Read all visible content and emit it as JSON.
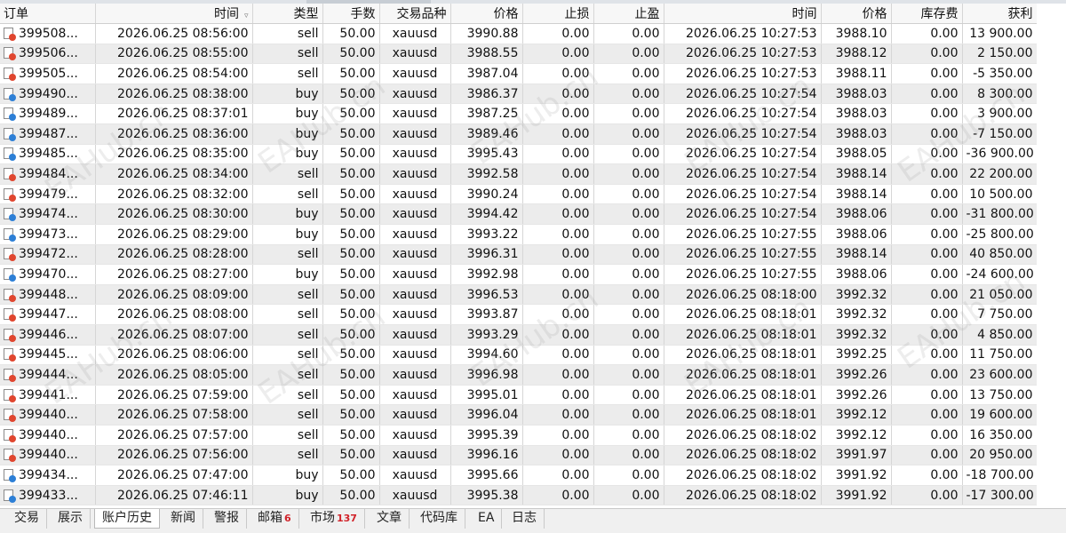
{
  "columns": {
    "order": "订单",
    "open_time": "时间",
    "type": "类型",
    "volume": "手数",
    "symbol": "交易品种",
    "open_price": "价格",
    "stop_loss": "止损",
    "take_profit": "止盈",
    "close_time": "时间",
    "close_price": "价格",
    "swap": "库存费",
    "profit": "获利"
  },
  "rows": [
    [
      "399508...",
      "2026.06.25 08:56:00",
      "sell",
      "50.00",
      "xauusd",
      "3990.88",
      "0.00",
      "0.00",
      "2026.06.25 10:27:53",
      "3988.10",
      "0.00",
      "13 900.00"
    ],
    [
      "399506...",
      "2026.06.25 08:55:00",
      "sell",
      "50.00",
      "xauusd",
      "3988.55",
      "0.00",
      "0.00",
      "2026.06.25 10:27:53",
      "3988.12",
      "0.00",
      "2 150.00"
    ],
    [
      "399505...",
      "2026.06.25 08:54:00",
      "sell",
      "50.00",
      "xauusd",
      "3987.04",
      "0.00",
      "0.00",
      "2026.06.25 10:27:53",
      "3988.11",
      "0.00",
      "-5 350.00"
    ],
    [
      "399490...",
      "2026.06.25 08:38:00",
      "buy",
      "50.00",
      "xauusd",
      "3986.37",
      "0.00",
      "0.00",
      "2026.06.25 10:27:54",
      "3988.03",
      "0.00",
      "8 300.00"
    ],
    [
      "399489...",
      "2026.06.25 08:37:01",
      "buy",
      "50.00",
      "xauusd",
      "3987.25",
      "0.00",
      "0.00",
      "2026.06.25 10:27:54",
      "3988.03",
      "0.00",
      "3 900.00"
    ],
    [
      "399487...",
      "2026.06.25 08:36:00",
      "buy",
      "50.00",
      "xauusd",
      "3989.46",
      "0.00",
      "0.00",
      "2026.06.25 10:27:54",
      "3988.03",
      "0.00",
      "-7 150.00"
    ],
    [
      "399485...",
      "2026.06.25 08:35:00",
      "buy",
      "50.00",
      "xauusd",
      "3995.43",
      "0.00",
      "0.00",
      "2026.06.25 10:27:54",
      "3988.05",
      "0.00",
      "-36 900.00"
    ],
    [
      "399484...",
      "2026.06.25 08:34:00",
      "sell",
      "50.00",
      "xauusd",
      "3992.58",
      "0.00",
      "0.00",
      "2026.06.25 10:27:54",
      "3988.14",
      "0.00",
      "22 200.00"
    ],
    [
      "399479...",
      "2026.06.25 08:32:00",
      "sell",
      "50.00",
      "xauusd",
      "3990.24",
      "0.00",
      "0.00",
      "2026.06.25 10:27:54",
      "3988.14",
      "0.00",
      "10 500.00"
    ],
    [
      "399474...",
      "2026.06.25 08:30:00",
      "buy",
      "50.00",
      "xauusd",
      "3994.42",
      "0.00",
      "0.00",
      "2026.06.25 10:27:54",
      "3988.06",
      "0.00",
      "-31 800.00"
    ],
    [
      "399473...",
      "2026.06.25 08:29:00",
      "buy",
      "50.00",
      "xauusd",
      "3993.22",
      "0.00",
      "0.00",
      "2026.06.25 10:27:55",
      "3988.06",
      "0.00",
      "-25 800.00"
    ],
    [
      "399472...",
      "2026.06.25 08:28:00",
      "sell",
      "50.00",
      "xauusd",
      "3996.31",
      "0.00",
      "0.00",
      "2026.06.25 10:27:55",
      "3988.14",
      "0.00",
      "40 850.00"
    ],
    [
      "399470...",
      "2026.06.25 08:27:00",
      "buy",
      "50.00",
      "xauusd",
      "3992.98",
      "0.00",
      "0.00",
      "2026.06.25 10:27:55",
      "3988.06",
      "0.00",
      "-24 600.00"
    ],
    [
      "399448...",
      "2026.06.25 08:09:00",
      "sell",
      "50.00",
      "xauusd",
      "3996.53",
      "0.00",
      "0.00",
      "2026.06.25 08:18:00",
      "3992.32",
      "0.00",
      "21 050.00"
    ],
    [
      "399447...",
      "2026.06.25 08:08:00",
      "sell",
      "50.00",
      "xauusd",
      "3993.87",
      "0.00",
      "0.00",
      "2026.06.25 08:18:01",
      "3992.32",
      "0.00",
      "7 750.00"
    ],
    [
      "399446...",
      "2026.06.25 08:07:00",
      "sell",
      "50.00",
      "xauusd",
      "3993.29",
      "0.00",
      "0.00",
      "2026.06.25 08:18:01",
      "3992.32",
      "0.00",
      "4 850.00"
    ],
    [
      "399445...",
      "2026.06.25 08:06:00",
      "sell",
      "50.00",
      "xauusd",
      "3994.60",
      "0.00",
      "0.00",
      "2026.06.25 08:18:01",
      "3992.25",
      "0.00",
      "11 750.00"
    ],
    [
      "399444...",
      "2026.06.25 08:05:00",
      "sell",
      "50.00",
      "xauusd",
      "3996.98",
      "0.00",
      "0.00",
      "2026.06.25 08:18:01",
      "3992.26",
      "0.00",
      "23 600.00"
    ],
    [
      "399441...",
      "2026.06.25 07:59:00",
      "sell",
      "50.00",
      "xauusd",
      "3995.01",
      "0.00",
      "0.00",
      "2026.06.25 08:18:01",
      "3992.26",
      "0.00",
      "13 750.00"
    ],
    [
      "399440...",
      "2026.06.25 07:58:00",
      "sell",
      "50.00",
      "xauusd",
      "3996.04",
      "0.00",
      "0.00",
      "2026.06.25 08:18:01",
      "3992.12",
      "0.00",
      "19 600.00"
    ],
    [
      "399440...",
      "2026.06.25 07:57:00",
      "sell",
      "50.00",
      "xauusd",
      "3995.39",
      "0.00",
      "0.00",
      "2026.06.25 08:18:02",
      "3992.12",
      "0.00",
      "16 350.00"
    ],
    [
      "399440...",
      "2026.06.25 07:56:00",
      "sell",
      "50.00",
      "xauusd",
      "3996.16",
      "0.00",
      "0.00",
      "2026.06.25 08:18:02",
      "3991.97",
      "0.00",
      "20 950.00"
    ],
    [
      "399434...",
      "2026.06.25 07:47:00",
      "buy",
      "50.00",
      "xauusd",
      "3995.66",
      "0.00",
      "0.00",
      "2026.06.25 08:18:02",
      "3991.92",
      "0.00",
      "-18 700.00"
    ],
    [
      "399433...",
      "2026.06.25 07:46:11",
      "buy",
      "50.00",
      "xauusd",
      "3995.38",
      "0.00",
      "0.00",
      "2026.06.25 08:18:02",
      "3991.92",
      "0.00",
      "-17 300.00"
    ]
  ],
  "tabs": [
    {
      "label": "交易"
    },
    {
      "label": "展示"
    },
    {
      "label": "账户历史",
      "active": true
    },
    {
      "label": "新闻"
    },
    {
      "label": "警报"
    },
    {
      "label": "邮箱",
      "badge": "6"
    },
    {
      "label": "市场",
      "badge": "137"
    },
    {
      "label": "文章"
    },
    {
      "label": "代码库"
    },
    {
      "label": "EA"
    },
    {
      "label": "日志"
    }
  ],
  "watermark": "EAHub.cn",
  "colors": {
    "sell_marker": "#e0462f",
    "buy_marker": "#2d7fd6",
    "badge": "#d1232a"
  },
  "icons": {
    "sort": "sort-down-arrow-icon",
    "order": "order-document-icon"
  }
}
